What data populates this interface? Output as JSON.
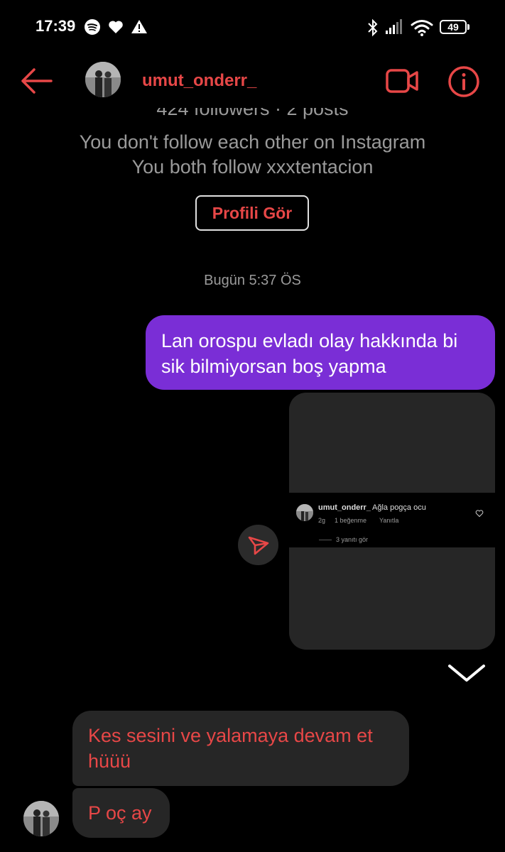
{
  "status_bar": {
    "time": "17:39",
    "battery": "49",
    "icons": [
      "spotify-icon",
      "heart-icon",
      "warning-icon",
      "bluetooth-icon",
      "signal-icon",
      "wifi-icon",
      "battery-icon"
    ]
  },
  "header": {
    "username": "umut_onderr_",
    "icons": [
      "back-arrow-icon",
      "avatar",
      "video-call-icon",
      "info-icon"
    ]
  },
  "profile": {
    "followers": "424 followers · 2 posts",
    "follow_status": "You don't follow each other on Instagram",
    "mutual": "You both follow xxxtentacion",
    "view_profile": "Profili Gör"
  },
  "timestamp": "Bugün 5:37 ÖS",
  "messages": {
    "sent": "Lan orospu evladı olay hakkında bi sik bilmiyorsan boş yapma",
    "received_1": "Kes sesini ve yalamaya devam et hüüü",
    "received_2": "P oç ay"
  },
  "shared_post": {
    "comment_user": "umut_onderr_",
    "comment_text": "Ağla pogça ocu",
    "comment_age": "2g",
    "comment_likes": "1 beğenme",
    "reply": "Yanıtla",
    "view_replies": "3 yanıtı gör"
  },
  "colors": {
    "accent": "#e74747",
    "sent_bubble": "#7a2ed6",
    "received_bubble": "#262626",
    "background": "#000000"
  }
}
